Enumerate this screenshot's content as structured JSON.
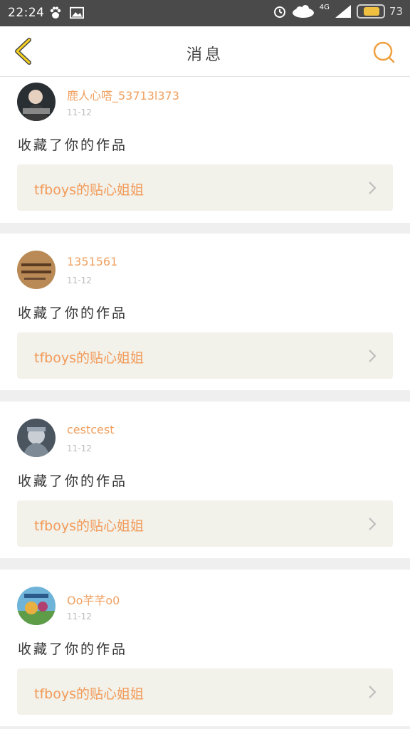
{
  "status_bar": {
    "time": "22:24",
    "network": "4G",
    "battery_level": "73",
    "icons": [
      "baidu-paw-icon",
      "image-icon",
      "alarm-icon",
      "cloud-icon",
      "signal-icon",
      "battery-icon"
    ]
  },
  "header": {
    "title": "消息",
    "back_icon": "chevron-left-icon",
    "search_icon": "search-icon",
    "accent": "#f0a040"
  },
  "notifications": [
    {
      "username": "鹿人心嗒_53713l373",
      "date": "11-12",
      "action": "收藏了你的作品",
      "work_title": "tfboys的贴心姐姐"
    },
    {
      "username": "1351561",
      "date": "11-12",
      "action": "收藏了你的作品",
      "work_title": "tfboys的贴心姐姐"
    },
    {
      "username": "cestcest",
      "date": "11-12",
      "action": "收藏了你的作品",
      "work_title": "tfboys的贴心姐姐"
    },
    {
      "username": "Oo芊芊o0",
      "date": "11-12",
      "action": "收藏了你的作品",
      "work_title": "tfboys的贴心姐姐"
    }
  ],
  "colors": {
    "username": "#f0a060",
    "work_title": "#f29a58",
    "work_box_bg": "#f2f1ea",
    "page_bg": "#efefef"
  }
}
